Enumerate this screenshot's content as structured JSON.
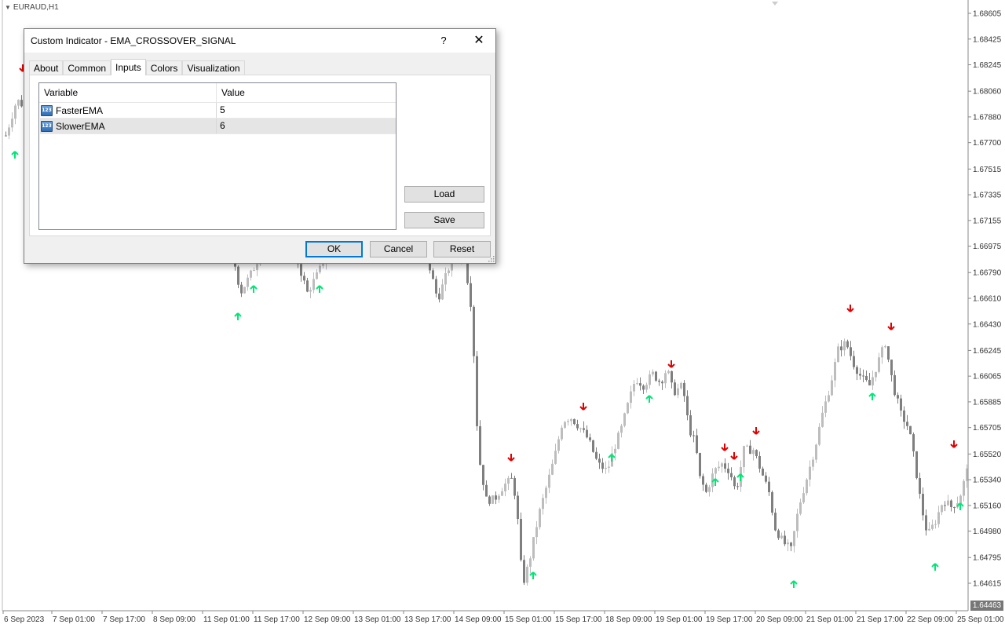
{
  "chart": {
    "symbol": "EURAUD,H1",
    "current_price": "1.64463",
    "price_labels": [
      {
        "v": 1.68605,
        "t": "1.68605"
      },
      {
        "v": 1.68425,
        "t": "1.68425"
      },
      {
        "v": 1.68245,
        "t": "1.68245"
      },
      {
        "v": 1.6806,
        "t": "1.68060"
      },
      {
        "v": 1.6788,
        "t": "1.67880"
      },
      {
        "v": 1.677,
        "t": "1.67700"
      },
      {
        "v": 1.67515,
        "t": "1.67515"
      },
      {
        "v": 1.67335,
        "t": "1.67335"
      },
      {
        "v": 1.67155,
        "t": "1.67155"
      },
      {
        "v": 1.66975,
        "t": "1.66975"
      },
      {
        "v": 1.6679,
        "t": "1.66790"
      },
      {
        "v": 1.6661,
        "t": "1.66610"
      },
      {
        "v": 1.6643,
        "t": "1.66430"
      },
      {
        "v": 1.66245,
        "t": "1.66245"
      },
      {
        "v": 1.66065,
        "t": "1.66065"
      },
      {
        "v": 1.65885,
        "t": "1.65885"
      },
      {
        "v": 1.65705,
        "t": "1.65705"
      },
      {
        "v": 1.6552,
        "t": "1.65520"
      },
      {
        "v": 1.6534,
        "t": "1.65340"
      },
      {
        "v": 1.6516,
        "t": "1.65160"
      },
      {
        "v": 1.6498,
        "t": "1.64980"
      },
      {
        "v": 1.64795,
        "t": "1.64795"
      },
      {
        "v": 1.64615,
        "t": "1.64615"
      }
    ],
    "time_labels": [
      "6 Sep 2023",
      "7 Sep 01:00",
      "7 Sep 17:00",
      "8 Sep 09:00",
      "11 Sep 01:00",
      "11 Sep 17:00",
      "12 Sep 09:00",
      "13 Sep 01:00",
      "13 Sep 17:00",
      "14 Sep 09:00",
      "15 Sep 01:00",
      "15 Sep 17:00",
      "18 Sep 09:00",
      "19 Sep 01:00",
      "19 Sep 17:00",
      "20 Sep 09:00",
      "21 Sep 01:00",
      "21 Sep 17:00",
      "22 Sep 09:00",
      "25 Sep 01:00"
    ],
    "colors": {
      "bull_candle": "#bdbdbd",
      "bear_candle": "#7f7f7f",
      "buy_arrow": "#00e676",
      "sell_arrow": "#e00000",
      "axis_text": "#333333"
    }
  },
  "dialog": {
    "title": "Custom Indicator - EMA_CROSSOVER_SIGNAL",
    "help": "?",
    "close": "✕",
    "tabs": [
      "About",
      "Common",
      "Inputs",
      "Colors",
      "Visualization"
    ],
    "active_tab": "Inputs",
    "grid": {
      "headers": {
        "variable": "Variable",
        "value": "Value"
      },
      "rows": [
        {
          "variable": "FasterEMA",
          "value": "5",
          "icon": "integer-icon",
          "selected": false
        },
        {
          "variable": "SlowerEMA",
          "value": "6",
          "icon": "integer-icon",
          "selected": true
        }
      ]
    },
    "buttons": {
      "load": "Load",
      "save": "Save",
      "ok": "OK",
      "cancel": "Cancel",
      "reset": "Reset"
    }
  }
}
